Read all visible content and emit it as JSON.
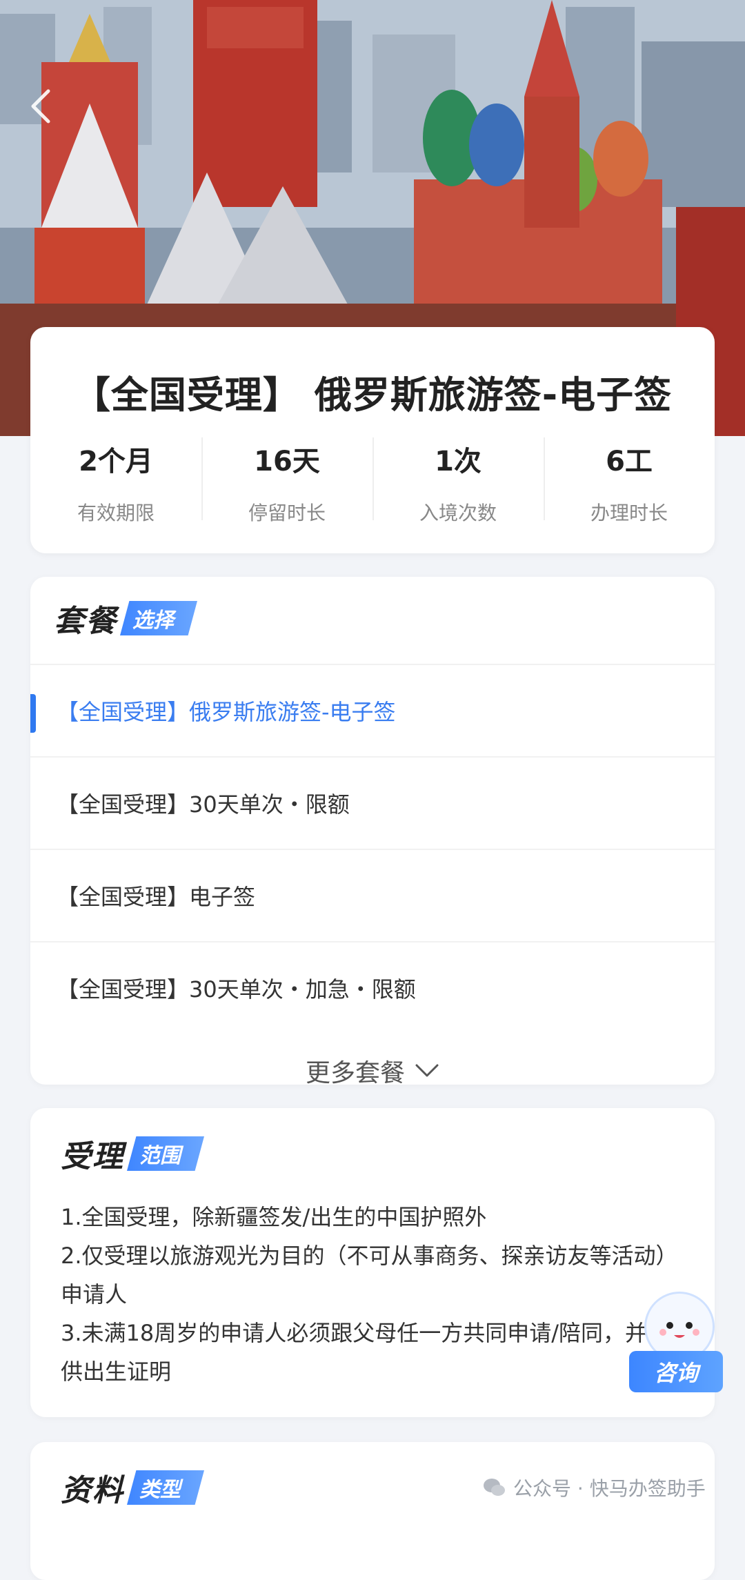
{
  "hero": {
    "image_description_icon": "kremlin-photo",
    "back_icon": "chevron-left-icon"
  },
  "info": {
    "title": "【全国受理】 俄罗斯旅游签-电子签",
    "stats": [
      {
        "value": "2个月",
        "label": "有效期限"
      },
      {
        "value": "16天",
        "label": "停留时长"
      },
      {
        "value": "1次",
        "label": "入境次数"
      },
      {
        "value": "6工",
        "label": "办理时长"
      }
    ]
  },
  "packages": {
    "heading": "套餐",
    "tag": "选择",
    "items": [
      {
        "label": "【全国受理】俄罗斯旅游签-电子签",
        "active": true
      },
      {
        "label": "【全国受理】30天单次・限额",
        "active": false
      },
      {
        "label": "【全国受理】电子签",
        "active": false
      },
      {
        "label": "【全国受理】30天单次・加急・限额",
        "active": false
      }
    ],
    "more_label": "更多套餐"
  },
  "scope": {
    "heading": "受理",
    "tag": "范围",
    "lines": [
      "1.全国受理，除新疆签发/出生的中国护照外",
      "2.仅受理以旅游观光为目的（不可从事商务、探亲访友等活动）申请人",
      "3.未满18周岁的申请人必须跟父母任一方共同申请/陪同，并提供出生证明"
    ]
  },
  "materials": {
    "heading": "资料",
    "tag": "类型"
  },
  "consult": {
    "label": "咨询"
  },
  "watermark": {
    "text": "公众号 · 快马办签助手"
  },
  "colors": {
    "accent": "#3a7df0",
    "background": "#f2f4f8"
  }
}
